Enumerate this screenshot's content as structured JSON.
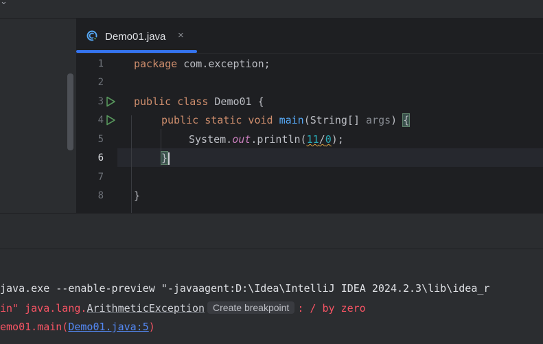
{
  "editor": {
    "tab": {
      "filename": "Demo01.java",
      "close_glyph": "×"
    },
    "lines": [
      {
        "n": "1"
      },
      {
        "n": "2"
      },
      {
        "n": "3"
      },
      {
        "n": "4"
      },
      {
        "n": "5"
      },
      {
        "n": "6"
      },
      {
        "n": "7"
      },
      {
        "n": "8"
      }
    ],
    "code": {
      "l1_kw": "package",
      "l1_rest": " com.exception;",
      "l3_kw": "public class",
      "l3_rest": " Demo01 {",
      "l4_kw": "public static void",
      "l4_fn": "main",
      "l4_a": "(String[] ",
      "l4_param": "args",
      "l4_b": ") ",
      "l4_brace": "{",
      "l5_a": "System.",
      "l5_out": "out",
      "l5_b": ".println(",
      "l5_n1": "11",
      "l5_slash": "/",
      "l5_n2": "0",
      "l5_c": ");",
      "l6_brace": "}",
      "l8_brace": "}"
    },
    "run_icon": "run-gutter-icon",
    "accent": "#3574f0"
  },
  "console": {
    "cmd": "java.exe --enable-preview \"-javaagent:D:\\Idea\\IntelliJ IDEA 2024.2.3\\lib\\idea_r",
    "err_prefix": "in\" java.lang.",
    "err_exception": "ArithmeticException",
    "breakpoint_label": "Create breakpoint",
    "err_suffix": ": / by zero",
    "trace_prefix": "emo01.main(",
    "trace_link": "Demo01.java:5",
    "trace_suffix": ")",
    "error_color": "#f75464"
  }
}
